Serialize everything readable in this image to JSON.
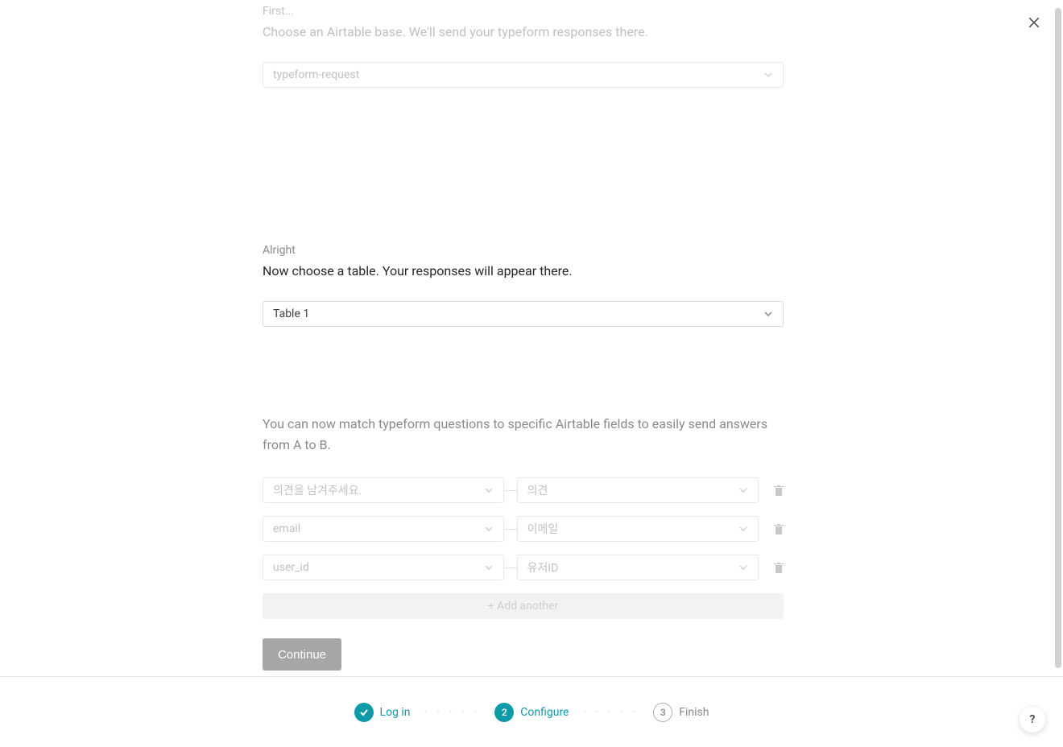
{
  "close_label": "Close",
  "help_label": "?",
  "section_base": {
    "pre": "First...",
    "title": "Choose an Airtable base. We'll send your typeform responses there.",
    "value": "typeform-request"
  },
  "section_table": {
    "pre": "Alright",
    "title": "Now choose a table. Your responses will appear there.",
    "value": "Table 1"
  },
  "match_text": "You can now match typeform questions to specific Airtable fields to easily send answers from A to B.",
  "mappings": [
    {
      "left": "의견을 남겨주세요.",
      "right": "의견"
    },
    {
      "left": "email",
      "right": "이메일"
    },
    {
      "left": "user_id",
      "right": "유저ID"
    }
  ],
  "add_another_label": "+ Add another",
  "continue_label": "Continue",
  "stepper": {
    "steps": [
      {
        "label": "Log in",
        "state": "done"
      },
      {
        "label": "Configure",
        "state": "active",
        "num": "2"
      },
      {
        "label": "Finish",
        "state": "pending",
        "num": "3"
      }
    ]
  }
}
